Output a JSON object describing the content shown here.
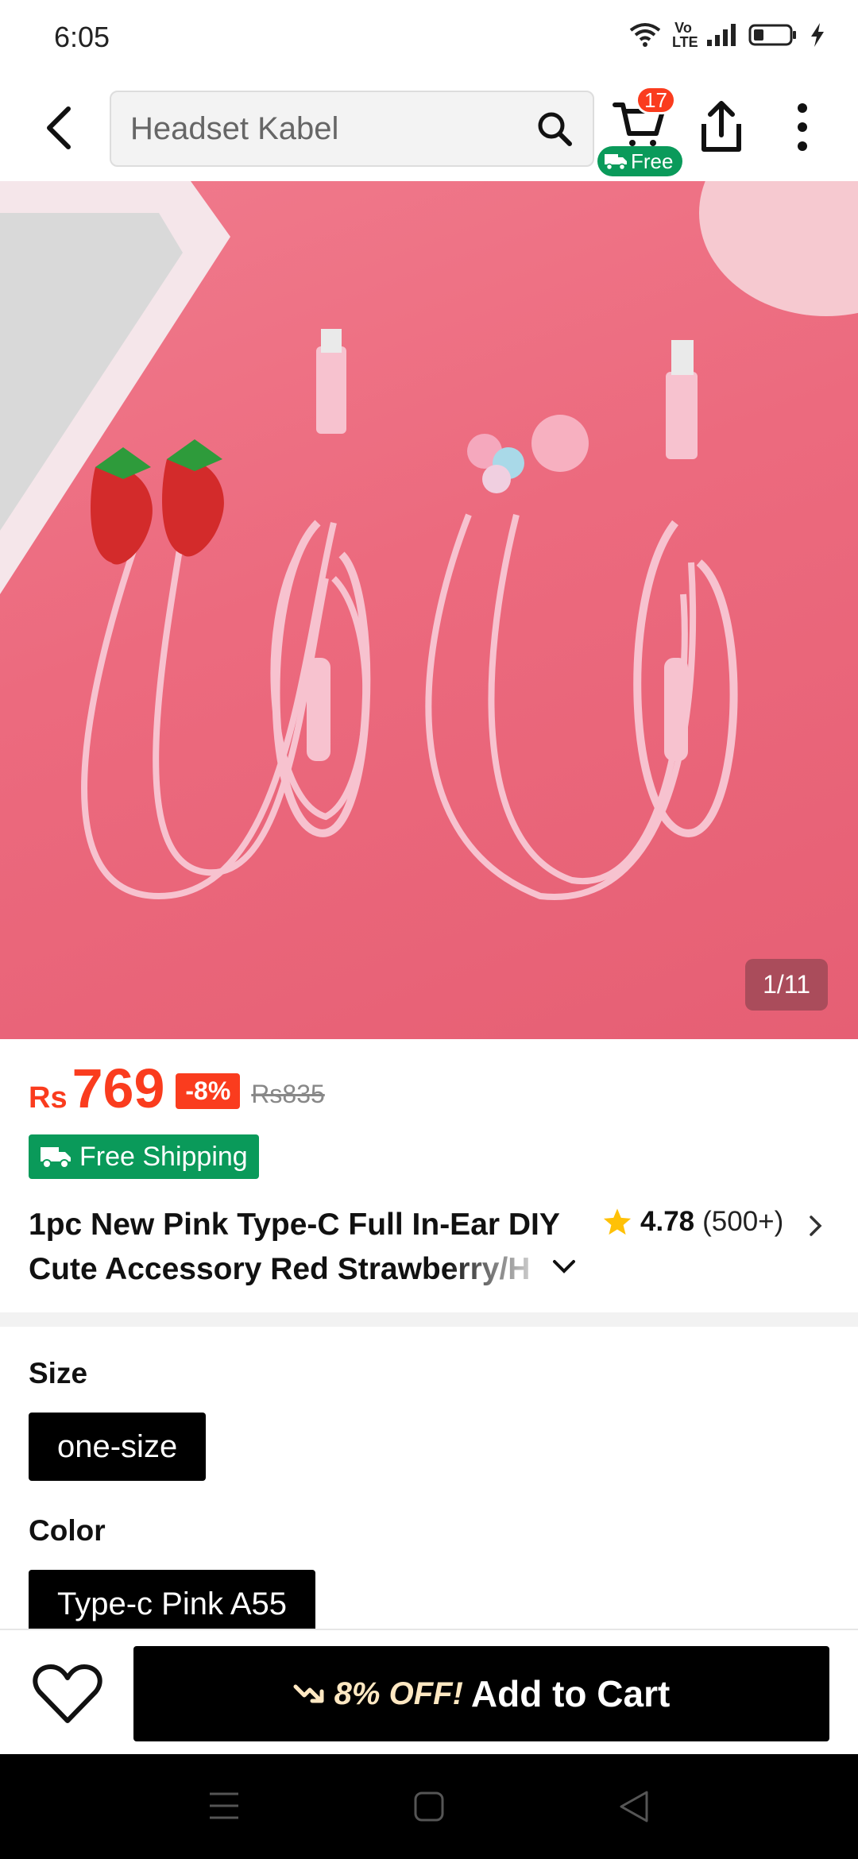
{
  "status_bar": {
    "time": "6:05",
    "icons": [
      "wifi-icon",
      "volte-icon",
      "signal-icon",
      "battery-icon",
      "charging-icon"
    ],
    "volte_label": "Vo LTE"
  },
  "top_nav": {
    "search_value": "Headset Kabel",
    "cart_count": "17",
    "free_label": "Free"
  },
  "product": {
    "image_counter": "1/11",
    "currency": "Rs",
    "price": "769",
    "discount": "-8%",
    "old_price": "Rs835",
    "shipping_label": "Free Shipping",
    "title": "1pc New Pink Type-C Full In-Ear DIY Cute Accessory Red Strawberry/H",
    "rating": "4.78",
    "rating_count": "(500+)"
  },
  "options": {
    "size_label": "Size",
    "size_value": "one-size",
    "color_label": "Color",
    "color_value": "Type-c Pink A55"
  },
  "action_bar": {
    "promo": "8% OFF!",
    "add_to_cart": "Add to Cart"
  },
  "colors": {
    "accent": "#fa3c1e",
    "shipping_green": "#0a9a5a",
    "image_pink": "#ec6a7e"
  }
}
